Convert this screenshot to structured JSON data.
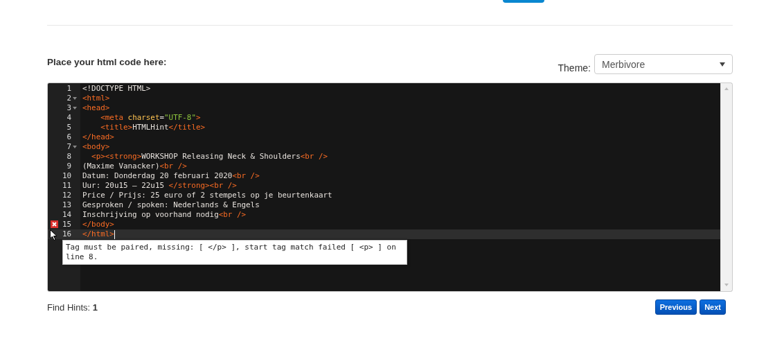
{
  "header": {
    "heading": "Place your html code here:",
    "theme": {
      "label": "Theme:",
      "value": "Merbivore"
    }
  },
  "editor": {
    "lines": [
      {
        "number": "1",
        "foldable": false,
        "error": false,
        "active": false,
        "tokens": [
          {
            "kind": "text",
            "text": "<!DOCTYPE HTML>"
          }
        ]
      },
      {
        "number": "2",
        "foldable": true,
        "error": false,
        "active": false,
        "tokens": [
          {
            "kind": "tag",
            "text": "<html>"
          }
        ]
      },
      {
        "number": "3",
        "foldable": true,
        "error": false,
        "active": false,
        "tokens": [
          {
            "kind": "tag",
            "text": "<head>"
          }
        ]
      },
      {
        "number": "4",
        "foldable": false,
        "error": false,
        "active": false,
        "tokens": [
          {
            "kind": "tag",
            "text": "    <meta "
          },
          {
            "kind": "attr",
            "text": "charset"
          },
          {
            "kind": "text",
            "text": "="
          },
          {
            "kind": "string",
            "text": "\"UTF-8\""
          },
          {
            "kind": "tag",
            "text": ">"
          }
        ]
      },
      {
        "number": "5",
        "foldable": false,
        "error": false,
        "active": false,
        "tokens": [
          {
            "kind": "tag",
            "text": "    <title>"
          },
          {
            "kind": "text",
            "text": "HTMLHint"
          },
          {
            "kind": "tag",
            "text": "</title>"
          }
        ]
      },
      {
        "number": "6",
        "foldable": false,
        "error": false,
        "active": false,
        "tokens": [
          {
            "kind": "tag",
            "text": "</head>"
          }
        ]
      },
      {
        "number": "7",
        "foldable": true,
        "error": false,
        "active": false,
        "tokens": [
          {
            "kind": "tag",
            "text": "<body>"
          }
        ]
      },
      {
        "number": "8",
        "foldable": false,
        "error": false,
        "active": false,
        "tokens": [
          {
            "kind": "tag",
            "text": "  <p><strong>"
          },
          {
            "kind": "text",
            "text": "WORKSHOP Releasing Neck & Shoulders"
          },
          {
            "kind": "tag",
            "text": "<br />"
          }
        ]
      },
      {
        "number": "9",
        "foldable": false,
        "error": false,
        "active": false,
        "tokens": [
          {
            "kind": "text",
            "text": "(Maxime Vanacker)"
          },
          {
            "kind": "tag",
            "text": "<br />"
          }
        ]
      },
      {
        "number": "10",
        "foldable": false,
        "error": false,
        "active": false,
        "tokens": [
          {
            "kind": "text",
            "text": "Datum: Donderdag 20 februari 2020"
          },
          {
            "kind": "tag",
            "text": "<br />"
          }
        ]
      },
      {
        "number": "11",
        "foldable": false,
        "error": false,
        "active": false,
        "tokens": [
          {
            "kind": "text",
            "text": "Uur: 20u15 – 22u15 "
          },
          {
            "kind": "tag",
            "text": "</strong><br />"
          }
        ]
      },
      {
        "number": "12",
        "foldable": false,
        "error": false,
        "active": false,
        "tokens": [
          {
            "kind": "text",
            "text": "Price / Prijs: 25 euro of 2 stempels op je beurtenkaart"
          }
        ]
      },
      {
        "number": "13",
        "foldable": false,
        "error": false,
        "active": false,
        "tokens": [
          {
            "kind": "text",
            "text": "Gesproken / spoken: Nederlands & Engels"
          }
        ]
      },
      {
        "number": "14",
        "foldable": false,
        "error": false,
        "active": false,
        "tokens": [
          {
            "kind": "text",
            "text": "Inschrijving op voorhand nodig"
          },
          {
            "kind": "tag",
            "text": "<br />"
          }
        ]
      },
      {
        "number": "15",
        "foldable": false,
        "error": true,
        "active": false,
        "tokens": [
          {
            "kind": "tag",
            "text": "</body>"
          }
        ]
      },
      {
        "number": "16",
        "foldable": false,
        "error": false,
        "active": true,
        "tokens": [
          {
            "kind": "tag",
            "text": "</html>"
          }
        ]
      }
    ],
    "tooltip": "Tag must be paired, missing: [ </p> ], start tag match failed [ <p> ] on line 8."
  },
  "footer": {
    "hints_label": "Find Hints:",
    "hints_count": "1",
    "buttons": [
      "Previous",
      "Next"
    ]
  }
}
